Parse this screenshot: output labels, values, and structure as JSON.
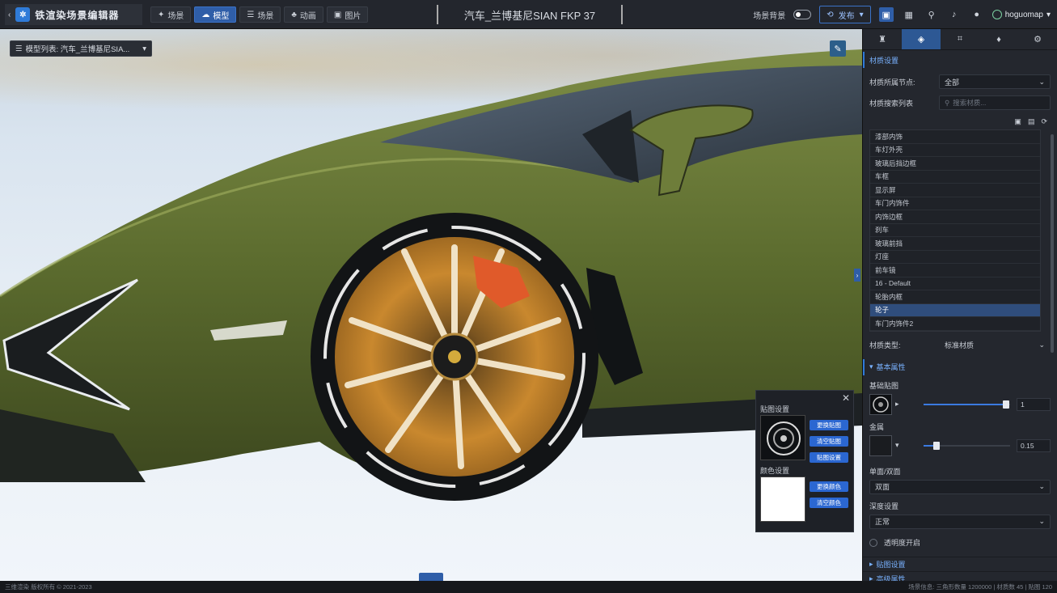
{
  "app": {
    "title": "铁渲染场景编辑器",
    "doc_title": "汽车_兰博基尼SIAN FKP 37"
  },
  "modes": [
    {
      "label": "场景",
      "active": false
    },
    {
      "label": "模型",
      "active": true
    },
    {
      "label": "场景",
      "active": false
    },
    {
      "label": "动画",
      "active": false
    },
    {
      "label": "图片",
      "active": false
    }
  ],
  "toolbar": {
    "toggle_label": "场景背景",
    "publish_label": "发布"
  },
  "user": {
    "name": "hoguomap"
  },
  "viewport": {
    "model_list_label": "模型列表: 汽车_兰博基尼SIA..."
  },
  "sidebar": {
    "section_title": "材质设置",
    "material_label": "材质所属节点:",
    "material_value": "全部",
    "search_label": "材质搜索列表",
    "search_placeholder": "搜索材质...",
    "materials": [
      "漆部内饰",
      "车灯外壳",
      "玻璃后挡边框",
      "车框",
      "显示屏",
      "车门内饰件",
      "内饰边框",
      "刹车",
      "玻璃前挡",
      "灯座",
      "前车镜",
      "16 - Default",
      "轮胎内框",
      "轮子",
      "车门内饰件2"
    ],
    "selected_material_index": 13,
    "shader_label": "材质类型:",
    "shader_value": "标准材质",
    "props_title": "基本属性",
    "base_color_label": "基础贴图",
    "base_color_value": "1",
    "base_color_level": 0.95,
    "metal_label": "金属",
    "metal_value": "0.15",
    "metal_level": 0.15,
    "blend_label": "单面/双面",
    "blend_value": "双面",
    "depth_label": "深度设置",
    "depth_value": "正常",
    "option_label": "透明度开启",
    "collapsed_1": "贴图设置",
    "collapsed_2": "高级属性"
  },
  "texture_panel": {
    "top_label": "贴图设置",
    "bottom_label": "颜色设置",
    "btn_1": "更换贴图",
    "btn_2": "清空贴图",
    "btn_3": "贴图设置",
    "btn_4": "更换颜色",
    "btn_5": "清空颜色"
  },
  "status": {
    "left": "三维渲染 版权所有 © 2021-2023",
    "right": "场景信息: 三角形数量 1200000 | 材质数 45 | 贴图 120"
  },
  "colors": {
    "accent": "#2f5ea8",
    "car_body": "#5b6b2e",
    "rim": "#c9882e",
    "brake_caliper": "#e05a2a"
  }
}
